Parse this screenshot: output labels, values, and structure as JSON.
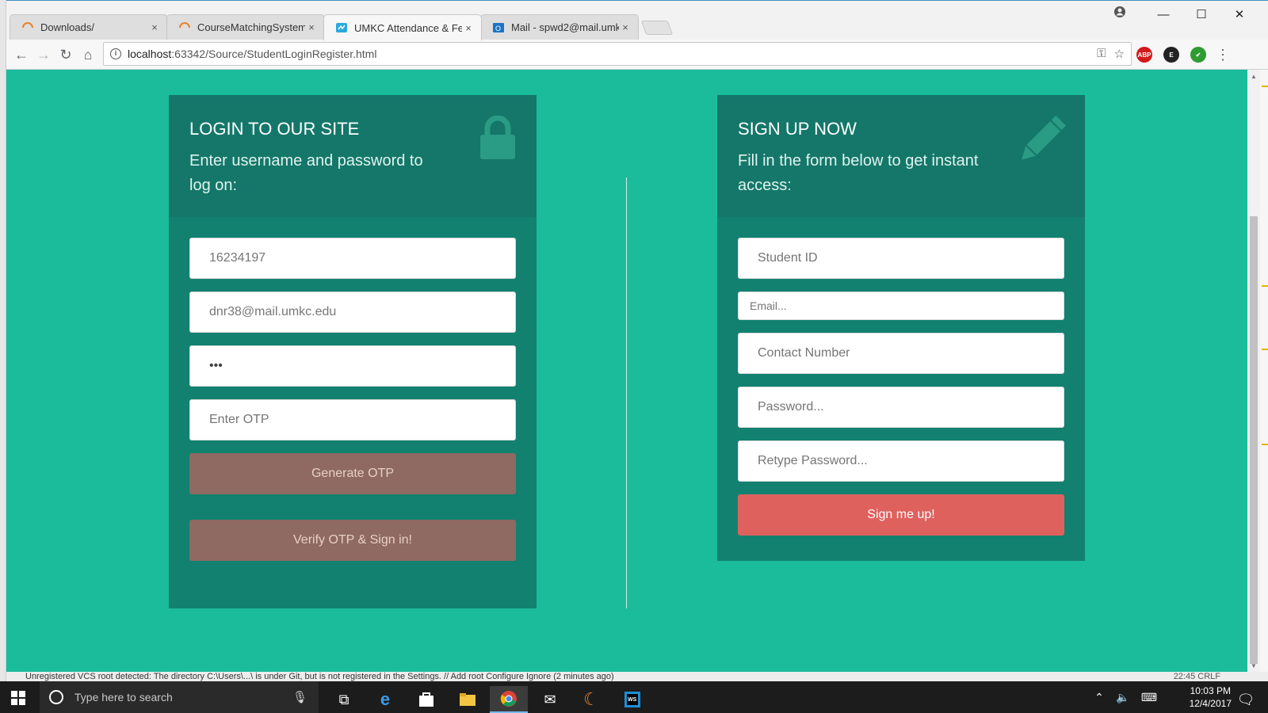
{
  "browser": {
    "tabs": [
      {
        "label": "Downloads/",
        "favicon": "loading-spinner-icon",
        "active": false
      },
      {
        "label": "CourseMatchingSystem",
        "favicon": "loading-spinner-icon",
        "active": false
      },
      {
        "label": "UMKC Attendance & Fee",
        "favicon": "page-icon",
        "active": true
      },
      {
        "label": "Mail - spwd2@mail.umk",
        "favicon": "outlook-icon",
        "active": false
      }
    ],
    "tab_close": "×",
    "url_host": "localhost",
    "url_rest": ":63342/Source/StudentLoginRegister.html",
    "window_controls": {
      "minimize": "—",
      "maximize": "☐",
      "close": "✕"
    },
    "extensions": [
      {
        "name": "adblock-plus-icon",
        "label": "ABP",
        "color": "#d21919"
      },
      {
        "name": "evernote-icon",
        "label": "E",
        "color": "#222222"
      },
      {
        "name": "checkmark-extension-icon",
        "label": "✔",
        "color": "#2e9c31"
      }
    ]
  },
  "login": {
    "title": "LOGIN TO OUR SITE",
    "subtitle": "Enter username and password to log on:",
    "student_id_value": "16234197",
    "email_value": "dnr38@mail.umkc.edu",
    "password_value": "•••",
    "otp_placeholder": "Enter OTP",
    "generate_otp_label": "Generate OTP",
    "verify_label": "Verify OTP & Sign in!"
  },
  "signup": {
    "title": "SIGN UP NOW",
    "subtitle": "Fill in the form below to get instant access:",
    "student_id_placeholder": "Student ID",
    "email_placeholder": "Email...",
    "contact_placeholder": "Contact Number",
    "password_placeholder": "Password...",
    "retype_placeholder": "Retype Password...",
    "submit_label": "Sign me up!"
  },
  "status_bar": {
    "text": "Unregistered VCS root detected: The directory C:\\Users\\...\\ is under Git, but is not registered in the Settings. // Add root  Configure  Ignore (2 minutes ago)",
    "right": "22:45  CRLF"
  },
  "taskbar": {
    "search_placeholder": "Type here to search",
    "time": "10:03 PM",
    "date": "12/4/2017"
  },
  "colors": {
    "page_bg": "#1abc9c",
    "panel": "#128170",
    "panel_head": "#14776a",
    "brown_button": "#8e6a62",
    "red_button": "#de615e"
  }
}
